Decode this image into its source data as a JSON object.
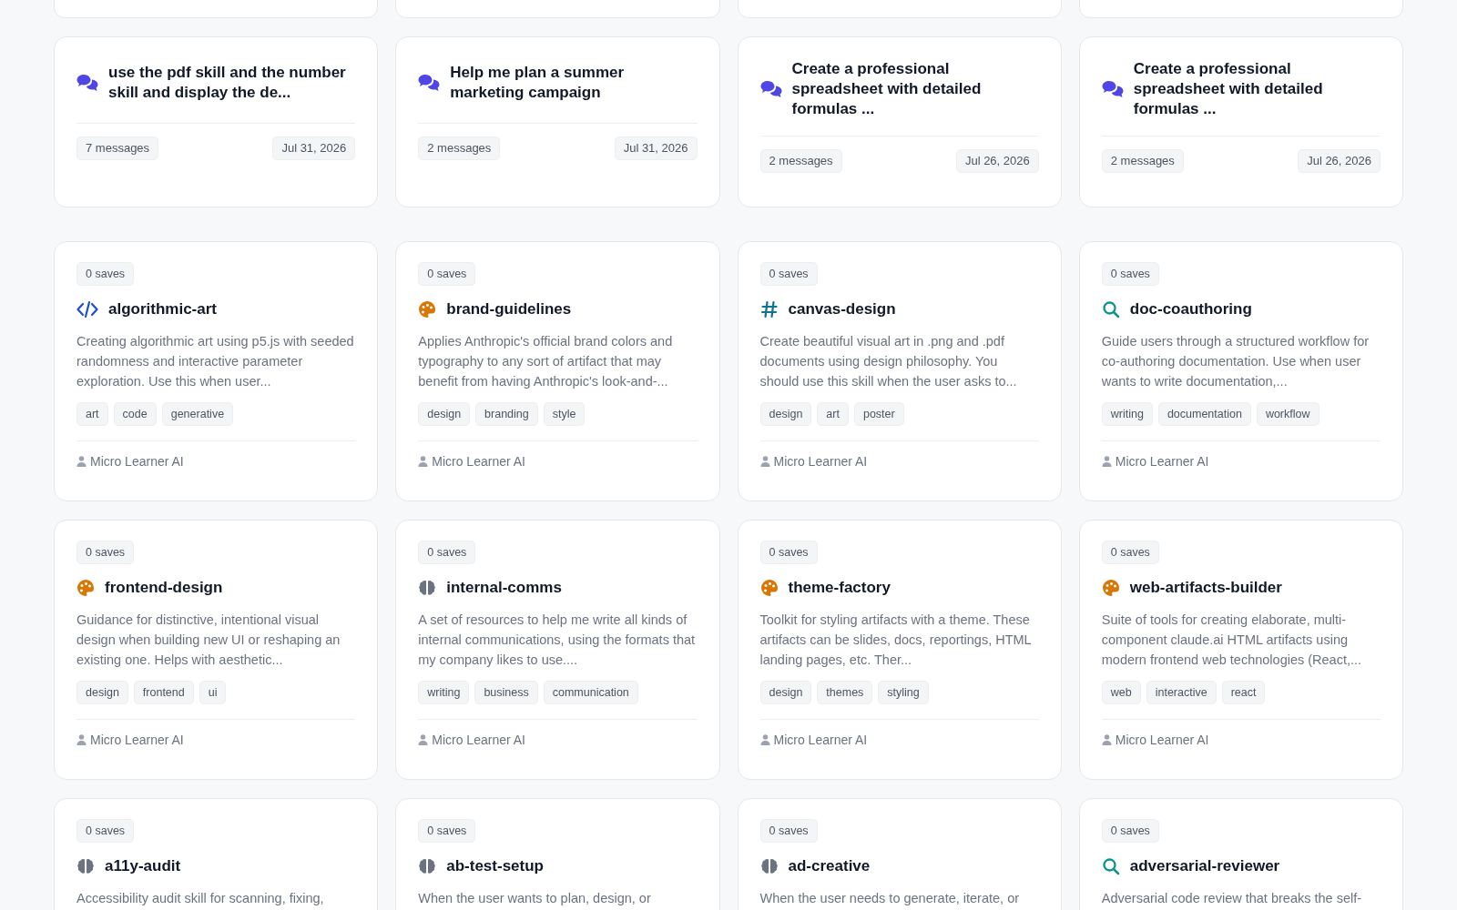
{
  "conversations": [
    {
      "title": "use the pdf skill and the number skill and display the de...",
      "messages": "7 messages",
      "date": "Jul 31, 2026"
    },
    {
      "title": "Help me plan a summer marketing campaign",
      "messages": "2 messages",
      "date": "Jul 31, 2026"
    },
    {
      "title": "Create a professional spreadsheet with detailed formulas ...",
      "messages": "2 messages",
      "date": "Jul 26, 2026"
    },
    {
      "title": "Create a professional spreadsheet with detailed formulas ...",
      "messages": "2 messages",
      "date": "Jul 26, 2026"
    }
  ],
  "skills": [
    {
      "saves": "0 saves",
      "kind": "code",
      "name": "algorithmic-art",
      "description": "Creating algorithmic art using p5.js with seeded randomness and interactive parameter exploration. Use this when user...",
      "tags": [
        "art",
        "code",
        "generative"
      ],
      "author": "Micro Learner AI"
    },
    {
      "saves": "0 saves",
      "kind": "palette",
      "name": "brand-guidelines",
      "description": "Applies Anthropic's official brand colors and typography to any sort of artifact that may benefit from having Anthropic's look-and-...",
      "tags": [
        "design",
        "branding",
        "style"
      ],
      "author": "Micro Learner AI"
    },
    {
      "saves": "0 saves",
      "kind": "hash",
      "name": "canvas-design",
      "description": "Create beautiful visual art in .png and .pdf documents using design philosophy. You should use this skill when the user asks to...",
      "tags": [
        "design",
        "art",
        "poster"
      ],
      "author": "Micro Learner AI"
    },
    {
      "saves": "0 saves",
      "kind": "search",
      "name": "doc-coauthoring",
      "description": "Guide users through a structured workflow for co-authoring documentation. Use when user wants to write documentation,...",
      "tags": [
        "writing",
        "documentation",
        "workflow"
      ],
      "author": "Micro Learner AI"
    },
    {
      "saves": "0 saves",
      "kind": "palette",
      "name": "frontend-design",
      "description": "Guidance for distinctive, intentional visual design when building new UI or reshaping an existing one. Helps with aesthetic...",
      "tags": [
        "design",
        "frontend",
        "ui"
      ],
      "author": "Micro Learner AI"
    },
    {
      "saves": "0 saves",
      "kind": "brain",
      "name": "internal-comms",
      "description": "A set of resources to help me write all kinds of internal communications, using the formats that my company likes to use....",
      "tags": [
        "writing",
        "business",
        "communication"
      ],
      "author": "Micro Learner AI"
    },
    {
      "saves": "0 saves",
      "kind": "palette",
      "name": "theme-factory",
      "description": "Toolkit for styling artifacts with a theme. These artifacts can be slides, docs, reportings, HTML landing pages, etc. Ther...",
      "tags": [
        "design",
        "themes",
        "styling"
      ],
      "author": "Micro Learner AI"
    },
    {
      "saves": "0 saves",
      "kind": "palette",
      "name": "web-artifacts-builder",
      "description": "Suite of tools for creating elaborate, multi-component claude.ai HTML artifacts using modern frontend web technologies (React,...",
      "tags": [
        "web",
        "interactive",
        "react"
      ],
      "author": "Micro Learner AI"
    },
    {
      "saves": "0 saves",
      "kind": "brain",
      "name": "a11y-audit",
      "description": "Accessibility audit skill for scanning, fixing,"
    },
    {
      "saves": "0 saves",
      "kind": "brain",
      "name": "ab-test-setup",
      "description": "When the user wants to plan, design, or"
    },
    {
      "saves": "0 saves",
      "kind": "brain",
      "name": "ad-creative",
      "description": "When the user needs to generate, iterate, or"
    },
    {
      "saves": "0 saves",
      "kind": "search",
      "name": "adversarial-reviewer",
      "description": "Adversarial code review that breaks the self-"
    }
  ]
}
